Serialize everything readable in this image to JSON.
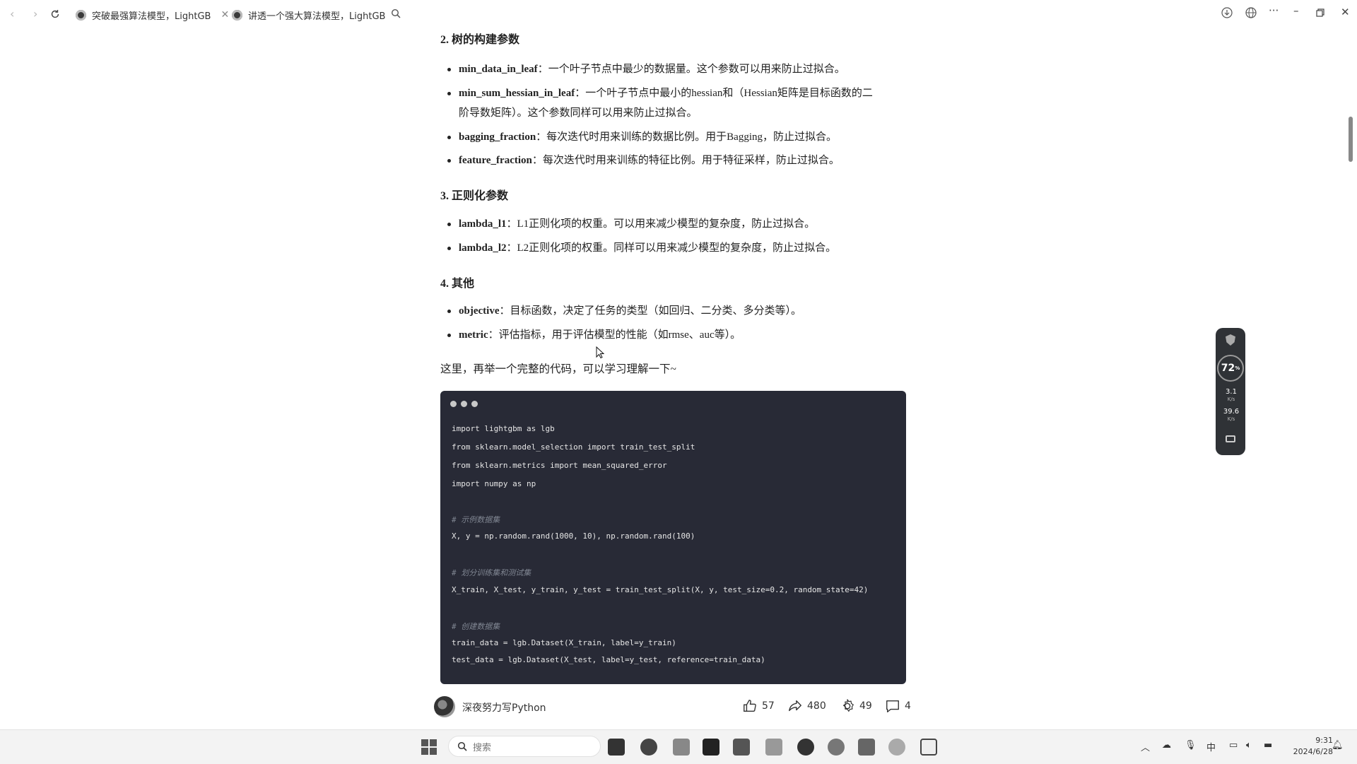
{
  "browser": {
    "tabs": [
      {
        "title": "突破最强算法模型，LightGB",
        "closable": true
      },
      {
        "title": "讲透一个强大算法模型，LightGB",
        "closable": false
      }
    ]
  },
  "article": {
    "sections": [
      {
        "heading": "2. 树的构建参数",
        "items": [
          {
            "name": "min_data_in_leaf",
            "desc": "：一个叶子节点中最少的数据量。这个参数可以用来防止过拟合。"
          },
          {
            "name": "min_sum_hessian_in_leaf",
            "desc": "：一个叶子节点中最小的hessian和（Hessian矩阵是目标函数的二",
            "desc2": "阶导数矩阵）。这个参数同样可以用来防止过拟合。"
          },
          {
            "name": "bagging_fraction",
            "desc": "：每次迭代时用来训练的数据比例。用于Bagging，防止过拟合。"
          },
          {
            "name": "feature_fraction",
            "desc": "：每次迭代时用来训练的特征比例。用于特征采样，防止过拟合。"
          }
        ]
      },
      {
        "heading": "3. 正则化参数",
        "items": [
          {
            "name": "lambda_l1",
            "desc": "：L1正则化项的权重。可以用来减少模型的复杂度，防止过拟合。"
          },
          {
            "name": "lambda_l2",
            "desc": "：L2正则化项的权重。同样可以用来减少模型的复杂度，防止过拟合。"
          }
        ]
      },
      {
        "heading": "4. 其他",
        "items": [
          {
            "name": "objective",
            "desc": "：目标函数，决定了任务的类型（如回归、二分类、多分类等）。"
          },
          {
            "name": "metric",
            "desc": "：评估指标，用于评估模型的性能（如rmse、auc等）。"
          }
        ]
      }
    ],
    "intro": "这里，再举一个完整的代码，可以学习理解一下~",
    "code_lines": [
      {
        "text": "import lightgbm as lgb",
        "comment": false
      },
      {
        "text": "from sklearn.model_selection import train_test_split",
        "comment": false
      },
      {
        "text": "from sklearn.metrics import mean_squared_error",
        "comment": false
      },
      {
        "text": "import numpy as np",
        "comment": false
      },
      {
        "text": "# 示例数据集",
        "comment": true
      },
      {
        "text": "X, y = np.random.rand(1000, 10), np.random.rand(100)",
        "comment": false
      },
      {
        "text": "# 划分训练集和测试集",
        "comment": true
      },
      {
        "text": "X_train, X_test, y_train, y_test = train_test_split(X, y, test_size=0.2, random_state=42)",
        "comment": false
      },
      {
        "text": "# 创建数据集",
        "comment": true
      },
      {
        "text": "train_data = lgb.Dataset(X_train, label=y_train)",
        "comment": false
      },
      {
        "text": "test_data = lgb.Dataset(X_test, label=y_test, reference=train_data)",
        "comment": false
      }
    ]
  },
  "author": {
    "name": "深夜努力写Python",
    "likes": "57",
    "shares": "480",
    "favorites": "49",
    "comments": "4"
  },
  "monitor": {
    "percent": "72",
    "percent_unit": "%",
    "up_speed": "3.1",
    "up_unit": "K/s",
    "down_speed": "39.6",
    "down_unit": "K/s"
  },
  "taskbar": {
    "search_placeholder": "搜索",
    "ime": "中",
    "time": "9:31",
    "date": "2024/6/28"
  }
}
